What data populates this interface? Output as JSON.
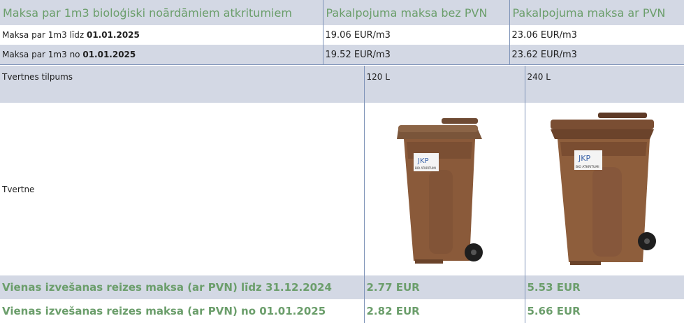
{
  "header": {
    "col1": "Maksa par 1m3 bioloģiski noārdāmiem atkritumiem",
    "col2": "Pakalpojuma maksa bez PVN",
    "col3": "Pakalpojuma maksa ar PVN"
  },
  "rates": [
    {
      "label_prefix": "Maksa par 1m3 līdz ",
      "label_date": "01.01.2025",
      "without_vat": "19.06 EUR/m3",
      "with_vat": "23.06 EUR/m3"
    },
    {
      "label_prefix": "Maksa par 1m3 no ",
      "label_date": "01.01.2025",
      "without_vat": "19.52 EUR/m3",
      "with_vat": "23.62 EUR/m3"
    }
  ],
  "bins": {
    "capacity_label": "Tvertnes tilpums",
    "container_label": "Tvertne",
    "sizes": [
      "120 L",
      "240 L"
    ],
    "logo_text": "JKP",
    "sticker_text": "BIO ATKRITUMI"
  },
  "prices": [
    {
      "label": "Vienas izvešanas reizes maksa (ar PVN) līdz 31.12.2024",
      "small": "2.77 EUR",
      "large": "5.53 EUR"
    },
    {
      "label": "Vienas izvešanas reizes maksa (ar PVN) no 01.01.2025",
      "small": "2.82 EUR",
      "large": "5.66 EUR"
    }
  ],
  "colors": {
    "header_bg": "#d3d8e4",
    "green_text": "#6b9e6b",
    "border": "#7e93b8",
    "bin_brown": "#8a5a3a"
  }
}
